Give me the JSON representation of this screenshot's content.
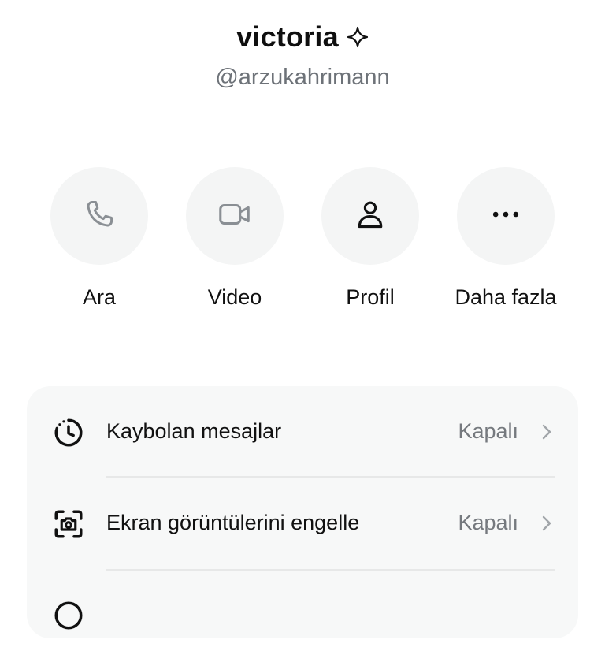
{
  "profile": {
    "name": "victoria",
    "handle": "@arzukahrimann"
  },
  "actions": [
    {
      "label": "Ara",
      "icon": "phone-icon"
    },
    {
      "label": "Video",
      "icon": "video-camera-icon"
    },
    {
      "label": "Profil",
      "icon": "person-icon"
    },
    {
      "label": "Daha fazla",
      "icon": "more-dots-icon"
    }
  ],
  "settings": [
    {
      "title": "Kaybolan mesajlar",
      "value": "Kapalı",
      "icon": "timer-clock-icon"
    },
    {
      "title": "Ekran görüntülerini engelle",
      "value": "Kapalı",
      "icon": "screenshot-camera-icon"
    }
  ],
  "colors": {
    "text_primary": "#111111",
    "text_secondary": "#6d7278",
    "circle_bg": "#f4f5f5",
    "card_bg": "#f7f8f8"
  }
}
